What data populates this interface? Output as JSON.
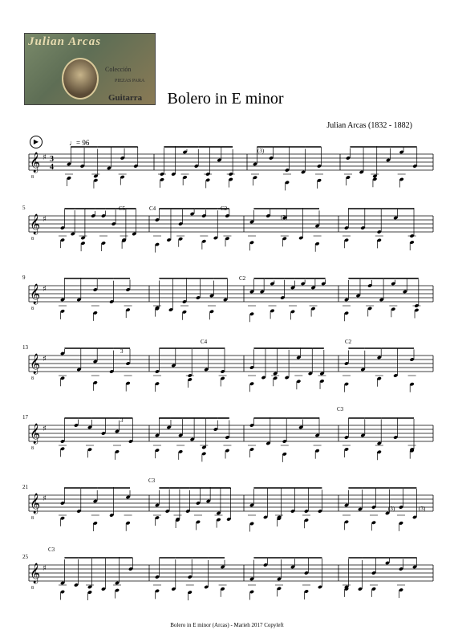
{
  "cover": {
    "line1": "Julian Arcas",
    "line2": "Colección",
    "line3": "Guitarra",
    "line4": "PIEZAS PARA"
  },
  "title": "Bolero in E minor",
  "composer": "Julian Arcas (1832 - 1882)",
  "tempo": "= 96",
  "time_signature": "3/4",
  "key": "E minor",
  "systems": [
    {
      "measure_start": "",
      "measures": 4
    },
    {
      "measure_start": "5",
      "measures": 4
    },
    {
      "measure_start": "9",
      "measures": 4
    },
    {
      "measure_start": "13",
      "measures": 4
    },
    {
      "measure_start": "17",
      "measures": 4
    },
    {
      "measure_start": "21",
      "measures": 4
    },
    {
      "measure_start": "25",
      "measures": 4
    }
  ],
  "annotations": {
    "c5": "C5",
    "c4a": "C4",
    "c2a": "C2",
    "c2b": "C2",
    "c4b": "C4",
    "c2c": "C2",
    "c3a": "C3",
    "c3b": "C3",
    "c3c": "C3",
    "f3a": "(3)",
    "f3b": "(3)",
    "trip1": "3",
    "trip2": "3",
    "f3c": "(3)",
    "f3d": "(3)"
  },
  "footer": "Bolero in E minor (Arcas) - Marieh 2017 Copyleft"
}
